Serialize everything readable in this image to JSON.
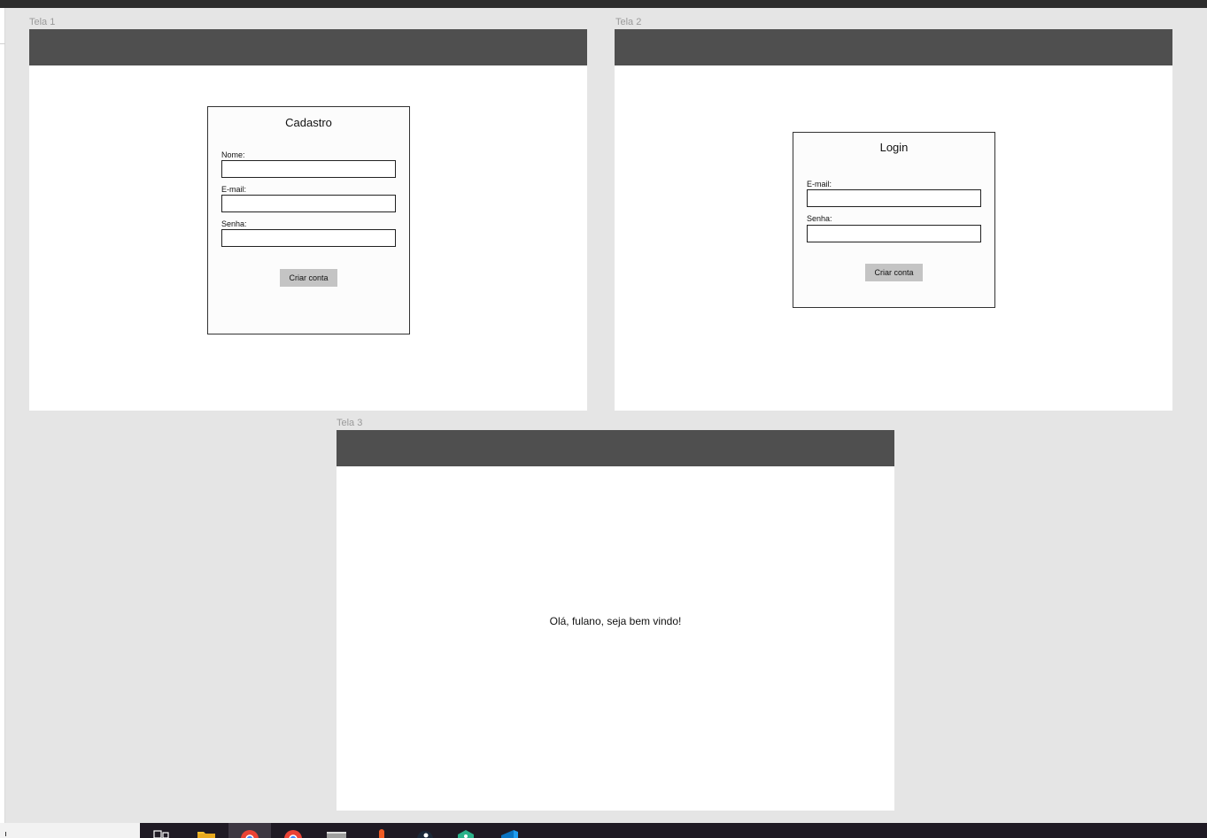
{
  "frames": [
    {
      "label": "Tela 1",
      "form": {
        "title": "Cadastro",
        "fields": [
          {
            "label": "Nome:",
            "value": ""
          },
          {
            "label": "E-mail:",
            "value": ""
          },
          {
            "label": "Senha:",
            "value": ""
          }
        ],
        "button_label": "Criar conta"
      }
    },
    {
      "label": "Tela 2",
      "form": {
        "title": "Login",
        "fields": [
          {
            "label": "E-mail:",
            "value": ""
          },
          {
            "label": "Senha:",
            "value": ""
          }
        ],
        "button_label": "Criar conta"
      }
    },
    {
      "label": "Tela 3",
      "message": "Olá, fulano, seja bem vindo!"
    }
  ],
  "colors": {
    "canvas": "#e5e5e5",
    "frame_header": "#4f4f4f",
    "button": "#c4c4c4",
    "taskbar": "#1f1a24"
  },
  "taskbar": {
    "icons": [
      "task-view-icon",
      "file-explorer-icon",
      "chrome-icon",
      "chrome-icon",
      "terminal-icon",
      "postman-icon",
      "steam-icon",
      "app-icon",
      "vscode-icon"
    ]
  }
}
